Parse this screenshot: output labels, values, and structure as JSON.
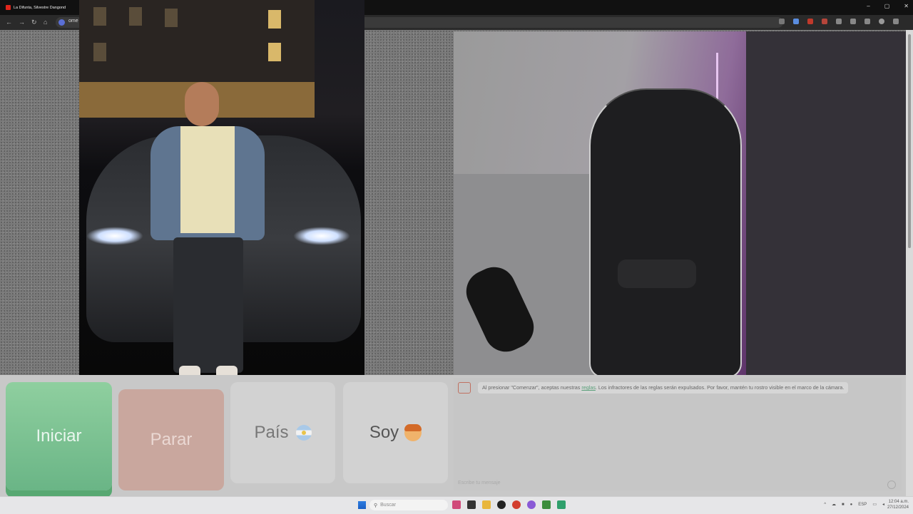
{
  "browser": {
    "tab_title": "La Difunta, Silvestre Dangond",
    "url": "ome",
    "window_controls": [
      "–",
      "▢",
      "✕"
    ],
    "nav": {
      "back": "←",
      "forward": "→",
      "reload": "↻",
      "home": "⌂"
    }
  },
  "controls": {
    "start_label": "Iniciar",
    "stop_label": "Parar",
    "country_label": "País",
    "gender_label": "Soy"
  },
  "chat": {
    "notice_before": "Al presionar \"Comenzar\", aceptas nuestras ",
    "notice_link": "reglas",
    "notice_after": ". Los infractores de las reglas serán expulsados. Por favor, mantén tu rostro visible en el marco de la cámara.",
    "input_placeholder": "Escribe tu mensaje"
  },
  "taskbar": {
    "search_placeholder": "Buscar",
    "language": "ESP",
    "time": "12:04 a.m.",
    "date": "27/12/2024"
  },
  "colors": {
    "start_green": "#6ab586",
    "stop_red": "#c9a79e",
    "link_green": "#5aa07a"
  }
}
